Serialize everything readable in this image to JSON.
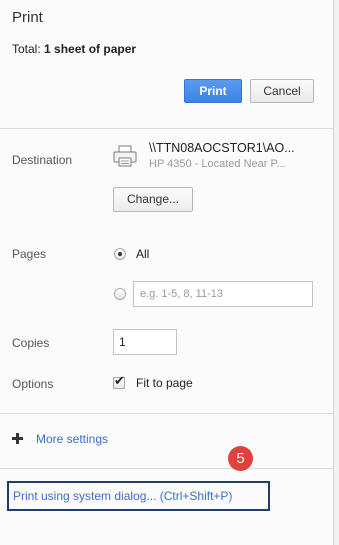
{
  "header": {
    "title": "Print",
    "total_prefix": "Total: ",
    "total_value": "1 sheet of paper"
  },
  "actions": {
    "print_label": "Print",
    "cancel_label": "Cancel"
  },
  "destination": {
    "label": "Destination",
    "name": "\\\\TTN08AOCSTOR1\\AO...",
    "subtitle": "HP 4350 - Located Near P...",
    "change_label": "Change...",
    "icon": "printer-icon"
  },
  "pages": {
    "label": "Pages",
    "all_label": "All",
    "range_placeholder": "e.g. 1-5, 8, 11-13",
    "selected": "All"
  },
  "copies": {
    "label": "Copies",
    "value": "1"
  },
  "options": {
    "label": "Options",
    "fit_to_page_label": "Fit to page",
    "fit_to_page_checked": true
  },
  "more_settings": {
    "label": "More settings",
    "icon": "plus-icon"
  },
  "annotation": {
    "badge": "5"
  },
  "system_dialog": {
    "label": "Print using system dialog... (Ctrl+Shift+P)"
  },
  "colors": {
    "primary": "#3c82e6",
    "link": "#3b6ec6",
    "badge": "#e0413a",
    "highlight_border": "#1f3c6e"
  }
}
